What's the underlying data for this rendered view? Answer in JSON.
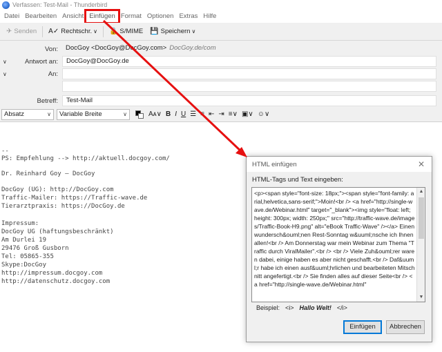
{
  "window": {
    "title": "Verfassen: Test-Mail - Thunderbird"
  },
  "menu": [
    {
      "label": "Datei"
    },
    {
      "label": "Bearbeiten"
    },
    {
      "label": "Ansicht"
    },
    {
      "label": "Einfügen"
    },
    {
      "label": "Format"
    },
    {
      "label": "Optionen"
    },
    {
      "label": "Extras"
    },
    {
      "label": "Hilfe"
    }
  ],
  "toolbar": {
    "send_label": "Senden",
    "spell_label": "Rechtschr.",
    "smime_label": "S/MIME",
    "save_label": "Speichern"
  },
  "headers": {
    "from_label": "Von:",
    "from_value": "DocGoy <DocGoy@DocGoy.com>",
    "from_identity": "DocGoy.de/com",
    "reply_label": "Antwort an:",
    "reply_value": "DocGoy@DocGoy.de",
    "to_label": "An:",
    "to_value": "",
    "subject_label": "Betreff:",
    "subject_value": "Test-Mail"
  },
  "format": {
    "paragraph_select": "Absatz",
    "font_select": "Variable Breite",
    "text_color": "#000000",
    "bg_color": "#ffffff"
  },
  "signature": [
    "--",
    "PS: Empfehlung --> http://aktuell.docgoy.com/",
    "",
    "Dr. Reinhard Goy – DocGoy",
    "",
    "DocGoy (UG): http://DocGoy.com",
    "Traffic-Mailer: https://Traffic-wave.de",
    "Tierarztpraxis: https://DocGoy.de",
    "",
    "Impressum:",
    "DocGoy UG (haftungsbeschränkt)",
    "Am Durlei 19",
    "29476 Groß Gusborn",
    "Tel: 05865-355",
    "Skype:DocGoy",
    "http://impressum.docgoy.com",
    "http://datenschutz.docgoy.com"
  ],
  "dialog": {
    "title": "HTML einfügen",
    "prompt": "HTML-Tags und Text eingeben:",
    "content": "<p><span style=\"font-size: 18px;\"><span style=\"font-family: arial,helvetica,sans-serif;\">Moin!<br /> <a href=\"http://single-wave.de/Webinar.html\" target=\"_blank\"><img style=\"float: left; height: 300px; width: 250px;\" src=\"http://traffic-wave.de/images/Traffic-Book-H9.png\" alt=\"eBook Traffic-Wave\" /></a> Einen wundersch&ouml;nen Rest-Sonntag w&uuml;nsche ich Ihnen allen!<br /> Am Donnerstag war mein Webinar zum Thema \"Traffic durch ViralMailer\".<br /> <br /> Viele Zuh&ouml;rer waren dabei, einige haben es aber nicht geschafft.<br /> Daf&uuml;r habe ich einen ausf&uuml;hrlichen und bearbeiteten Mitschnitt angefertigt.<br /> Sie finden alles auf dieser Seite<br /> <a href=\"http://single-wave.de/Webinar.html\"",
    "example_label": "Beispiel:",
    "example_open": "<i>",
    "example_text": "Hallo Welt!",
    "example_close": "</i>",
    "insert_button": "Einfügen",
    "cancel_button": "Abbrechen"
  },
  "colors": {
    "highlight": "#e61010",
    "accent": "#0078d7"
  }
}
